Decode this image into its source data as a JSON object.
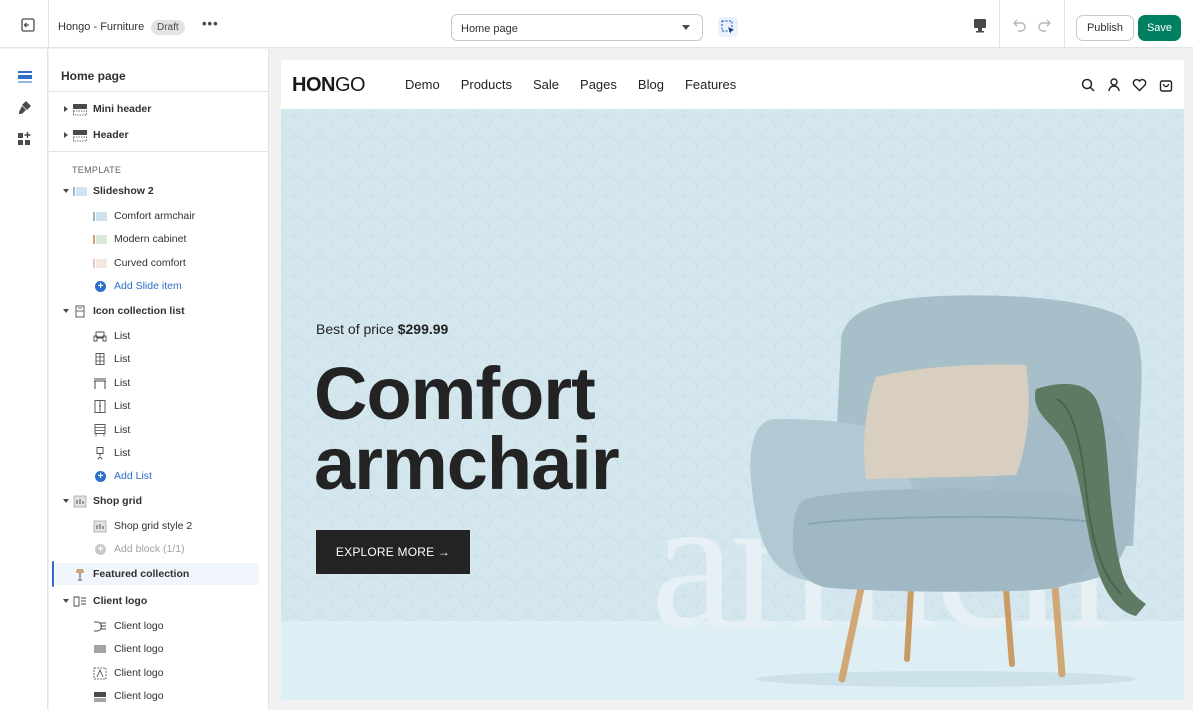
{
  "topbar": {
    "store_name": "Hongo - Furniture",
    "status_badge": "Draft",
    "more_label": "•••",
    "page_selector_value": "Home page",
    "publish_label": "Publish",
    "save_label": "Save"
  },
  "panel": {
    "title": "Home page",
    "header_sections": [
      {
        "label": "Mini header"
      },
      {
        "label": "Header"
      }
    ],
    "template_label": "TEMPLATE",
    "slideshow": {
      "label": "Slideshow 2",
      "items": [
        "Comfort armchair",
        "Modern cabinet",
        "Curved comfort"
      ],
      "add_label": "Add Slide item"
    },
    "icon_collection": {
      "label": "Icon collection list",
      "items": [
        "List",
        "List",
        "List",
        "List",
        "List",
        "List"
      ],
      "add_label": "Add List"
    },
    "shop_grid": {
      "label": "Shop grid",
      "items": [
        "Shop grid style 2"
      ],
      "add_label": "Add block (1/1)"
    },
    "featured_collection": {
      "label": "Featured collection"
    },
    "client_logo": {
      "label": "Client logo",
      "items": [
        "Client logo",
        "Client logo",
        "Client logo",
        "Client logo"
      ]
    }
  },
  "preview": {
    "logo_bold": "HON",
    "logo_light": "GO",
    "nav": [
      "Demo",
      "Products",
      "Sale",
      "Pages",
      "Blog",
      "Features"
    ],
    "hero": {
      "price_prefix": "Best of price",
      "price_value": "$299.99",
      "title_line1": "Comfort",
      "title_line2": "armchair",
      "cta_label": "EXPLORE MORE →",
      "watermark": "armch"
    }
  },
  "colors": {
    "accent_blue": "#2c6ecb",
    "save_green": "#008060",
    "hero_bg": "#d4e6ee",
    "dark": "#232323"
  }
}
